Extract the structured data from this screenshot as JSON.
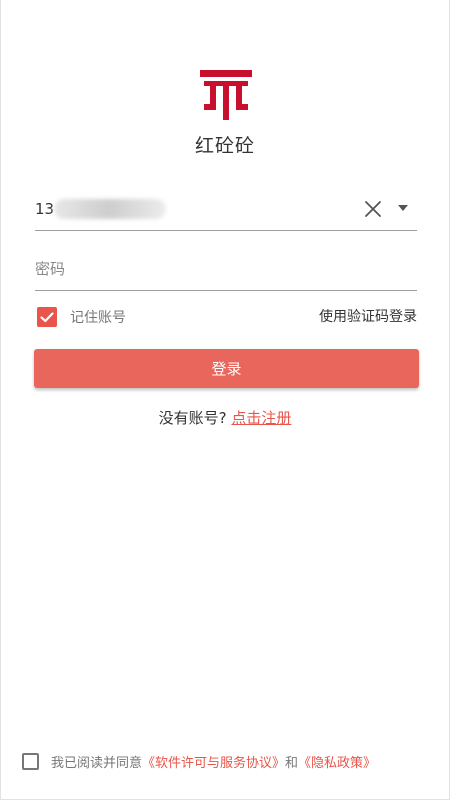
{
  "app": {
    "name": "红砼砼"
  },
  "login_form": {
    "phone_value": "13",
    "password_placeholder": "密码",
    "remember_label": "记住账号",
    "remember_checked": true,
    "sms_login_label": "使用验证码登录",
    "login_button_label": "登录"
  },
  "register": {
    "prompt": "没有账号?",
    "link_label": "点击注册"
  },
  "agreement": {
    "checked": false,
    "prefix": "我已阅读并同意",
    "terms_link": "《软件许可与服务协议》",
    "and_text": "和",
    "privacy_link": "《隐私政策》"
  },
  "icons": {
    "logo": "brand-logo-icon",
    "clear": "close-icon",
    "dropdown": "caret-down-icon",
    "check": "checkmark-icon"
  },
  "colors": {
    "brand_red": "#c8102e",
    "accent": "#e8554a",
    "button": "#e8665c"
  }
}
